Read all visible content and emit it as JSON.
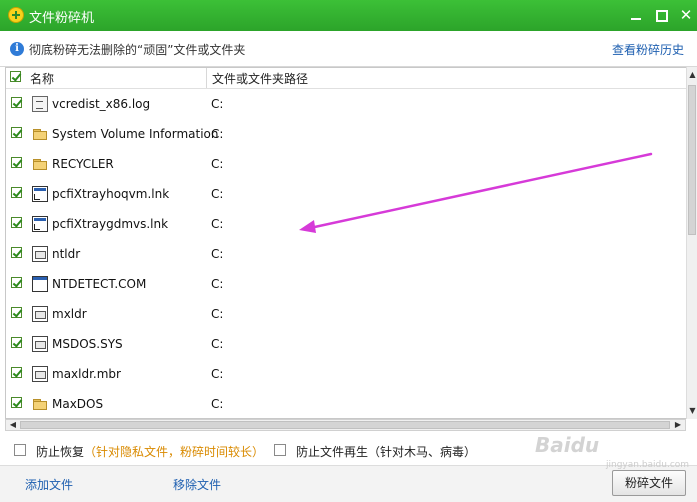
{
  "window": {
    "title": "文件粉碎机",
    "minimize_icon": "minimize-icon",
    "maximize_icon": "maximize-icon",
    "close_glyph": "✕"
  },
  "info": {
    "icon_glyph": "i",
    "text": "彻底粉碎无法删除的“顽固”文件或文件夹",
    "history_link": "查看粉碎历史"
  },
  "list": {
    "columns": {
      "name": "名称",
      "path": "文件或文件夹路径"
    },
    "items": [
      {
        "name": "vcredist_x86.log",
        "path": "C:",
        "icon": "file-icon"
      },
      {
        "name": "System Volume Information",
        "path": "C:",
        "icon": "folder-icon"
      },
      {
        "name": "RECYCLER",
        "path": "C:",
        "icon": "folder-icon"
      },
      {
        "name": "pcfiXtrayhoqvm.lnk",
        "path": "C:",
        "icon": "shortcut-icon"
      },
      {
        "name": "pcfiXtraygdmvs.lnk",
        "path": "C:",
        "icon": "shortcut-icon"
      },
      {
        "name": "ntldr",
        "path": "C:",
        "icon": "system-file-icon"
      },
      {
        "name": "NTDETECT.COM",
        "path": "C:",
        "icon": "executable-icon"
      },
      {
        "name": "mxldr",
        "path": "C:",
        "icon": "system-file-icon"
      },
      {
        "name": "MSDOS.SYS",
        "path": "C:",
        "icon": "system-file-icon"
      },
      {
        "name": "maxldr.mbr",
        "path": "C:",
        "icon": "system-file-icon"
      },
      {
        "name": "MaxDOS",
        "path": "C:",
        "icon": "folder-icon"
      }
    ]
  },
  "scroll": {
    "up": "▲",
    "down": "▼",
    "left": "◀",
    "right": "▶"
  },
  "options": {
    "prevent_recovery": "防止恢复",
    "prevent_recovery_note": "（针对隐私文件，粉碎时间较长）",
    "prevent_regeneration": "防止文件再生（针对木马、病毒）"
  },
  "actions": {
    "add_file": "添加文件",
    "remove_file": "移除文件",
    "shred_button": "粉碎文件"
  },
  "watermark": {
    "brand": "Baidu",
    "sub": "jingyan.baidu.com"
  },
  "colors": {
    "title_bar": "#2ca42a",
    "annotation_arrow": "#d63ad8",
    "link": "#1e5fb0"
  }
}
